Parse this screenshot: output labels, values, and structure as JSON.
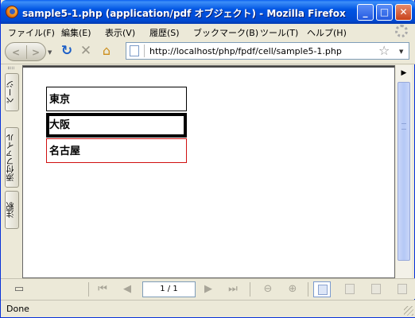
{
  "window": {
    "title": "sample5-1.php (application/pdf オブジェクト) - Mozilla Firefox",
    "buttons": {
      "minimize": "_",
      "maximize": "□",
      "close": "✕"
    }
  },
  "menu": [
    "ファイル(F)",
    "編集(E)",
    "表示(V)",
    "履歴(S)",
    "ブックマーク(B)",
    "ツール(T)",
    "ヘルプ(H)"
  ],
  "nav": {
    "url": "http://localhost/php/fpdf/cell/sample5-1.php",
    "icons": [
      "back-icon",
      "forward-icon",
      "reload-icon",
      "stop-icon",
      "home-icon",
      "page-icon",
      "bookmark-star-icon"
    ]
  },
  "sidebar": {
    "tabs": [
      "ページ",
      "添付ファイル",
      "注釈"
    ]
  },
  "document": {
    "cells": [
      "東京",
      "大阪",
      "名古屋"
    ]
  },
  "pdf_toolbar": {
    "page_indicator": "1 / 1"
  },
  "status": {
    "text": "Done"
  },
  "colors": {
    "title_bar": "#0054e3",
    "cell_border_red": "#d01010"
  }
}
